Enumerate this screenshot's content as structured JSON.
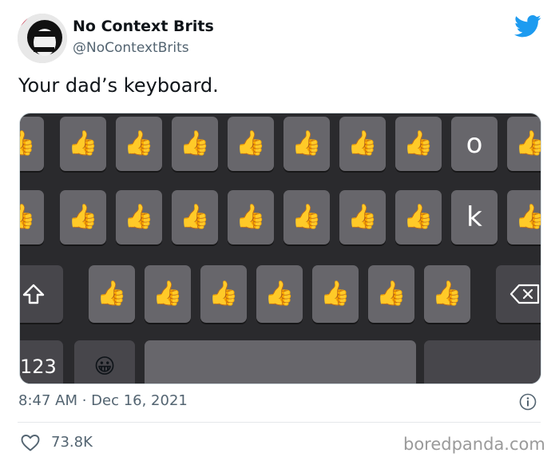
{
  "author": {
    "display_name": "No Context Brits",
    "handle": "@NoContextBrits",
    "avatar_icon": "avatar-image"
  },
  "tweet": {
    "text": "Your dad’s keyboard.",
    "timestamp": "8:47 AM · Dec 16, 2021",
    "likes": "73.8K"
  },
  "keyboard": {
    "row1_letter": "o",
    "row2_letter": "k",
    "numbers_key": "123",
    "key_emoji": "👍",
    "emoji_key": "😀",
    "shift_icon": "shift-icon",
    "backspace_icon": "backspace-icon"
  },
  "watermark": "boredpanda.com",
  "colors": {
    "twitter_blue": "#1d9bf0",
    "secondary_text": "#536471",
    "keyboard_bg": "#2a2a2d",
    "key_bg": "#67666b"
  }
}
